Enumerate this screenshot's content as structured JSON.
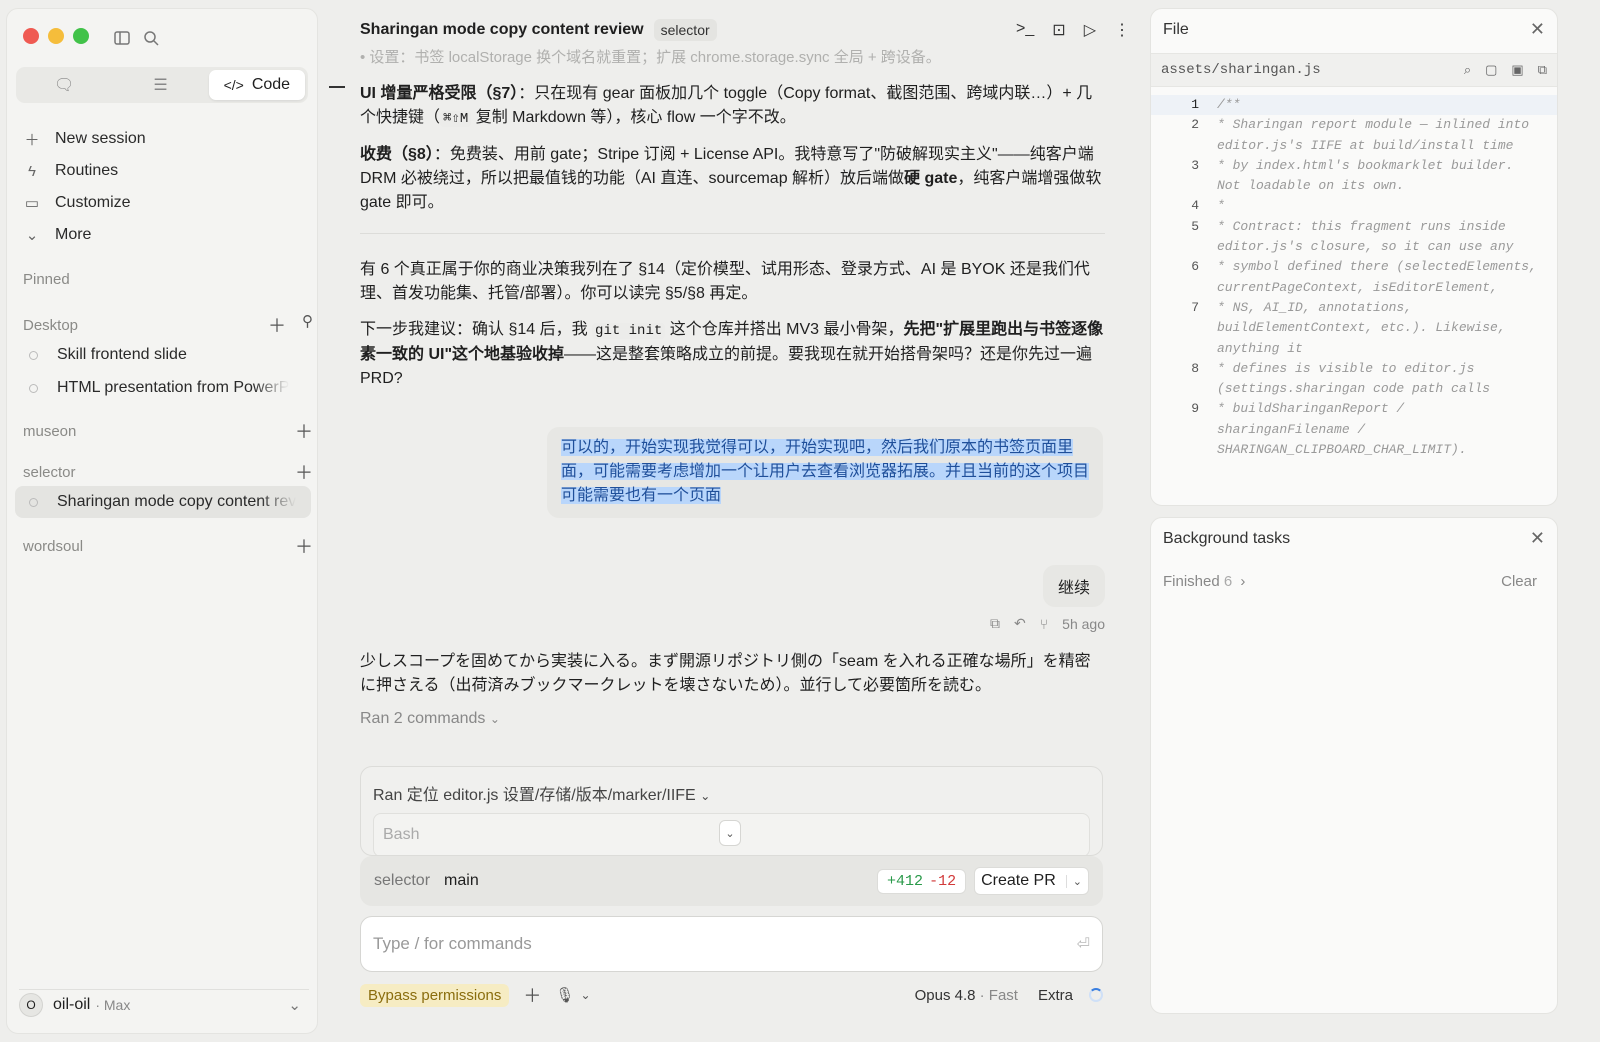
{
  "sidebar": {
    "tabs": [
      {
        "label": "",
        "icon": "chat-icon"
      },
      {
        "label": "",
        "icon": "checklist-icon"
      },
      {
        "label": "Code",
        "icon": "code-icon"
      }
    ],
    "nav": [
      {
        "label": "New session",
        "icon": "plus-icon"
      },
      {
        "label": "Routines",
        "icon": "bolt-icon"
      },
      {
        "label": "Customize",
        "icon": "briefcase-icon"
      },
      {
        "label": "More",
        "icon": "chevron-down-icon"
      }
    ],
    "pinned_label": "Pinned",
    "desktop_label": "Desktop",
    "desktop_sessions": [
      "Skill frontend slide",
      "HTML presentation from PowerP"
    ],
    "museon_label": "museon",
    "selector_label": "selector",
    "selector_session": "Sharingan mode copy content rev",
    "wordsoul_label": "wordsoul",
    "user": {
      "avatar": "O",
      "name": "oil-oil",
      "plan": "· Max"
    }
  },
  "header": {
    "title": "Sharingan mode copy content review",
    "chip": "selector"
  },
  "conversation": {
    "faded_line": "• 设置：书签 localStorage 换个域名就重置；扩展 chrome.storage.sync 全局 + 跨设备。",
    "p1_a": "UI 增量严格受限（§7）",
    "p1_b": "：只在现有 gear 面板加几个 toggle（Copy format、截图范围、跨域内联…）+ 几个快捷键（",
    "p1_kbd": "⌘⇧M",
    "p1_c": " 复制 Markdown 等），核心 flow 一个字不改。",
    "p2_a": "收费（§8）",
    "p2_b": "：免费装、用前 gate；Stripe 订阅 + License API。我特意写了\"防破解现实主义\"——纯客户端 DRM 必被绕过，所以把最值钱的功能（AI 直连、sourcemap 解析）放后端做",
    "p2_c": "硬 gate",
    "p2_d": "，纯客户端增强做软 gate 即可。",
    "p3": "有 6 个真正属于你的商业决策我列在了 §14（定价模型、试用形态、登录方式、AI 是 BYOK 还是我们代理、首发功能集、托管/部署）。你可以读完 §5/§8 再定。",
    "p4_a": "下一步我建议：确认 §14 后，我 ",
    "p4_code": "git init",
    "p4_b": " 这个仓库并搭出 MV3 最小骨架，",
    "p4_c": "先把\"扩展里跑出与书签逐像素一致的 UI\"这个地基验收掉",
    "p4_d": "——这是整套策略成立的前提。要我现在就开始搭骨架吗？还是你先过一遍 PRD?",
    "user_msg": "可以的，开始实现我觉得可以，开始实现吧，然后我们原本的书签页面里面，可能需要考虑增加一个让用户去查看浏览器拓展。并且当前的这个项目可能需要也有一个页面",
    "user_msg2": "继续",
    "time_ago": "5h ago",
    "reply": "少しスコープを固めてから実装に入る。まず開源リポジトリ側の「seam を入れる正確な場所」を精密に押さえる（出荷済みブックマークレットを壊さないため）。並行して必要箇所を読む。",
    "ran_commands": "Ran 2 commands",
    "cmd_title": "Ran 定位 editor.js 设置/存储/版本/marker/IIFE",
    "bash_label": "Bash"
  },
  "git": {
    "repo": "selector",
    "branch": "main",
    "added": "+412",
    "removed": "-12",
    "create_pr": "Create PR"
  },
  "composer": {
    "placeholder": "Type / for commands",
    "bypass": "Bypass permissions",
    "model": "Opus 4.8",
    "fast": " · Fast",
    "extra": "Extra"
  },
  "file_panel": {
    "title": "File",
    "path": "assets/sharingan.js",
    "lines": [
      {
        "n": "1",
        "text": "/**"
      },
      {
        "n": "2",
        "text": " * Sharingan report module — inlined into editor.js's IIFE at build/install time"
      },
      {
        "n": "3",
        "text": " * by index.html's bookmarklet builder. Not loadable on its own."
      },
      {
        "n": "4",
        "text": " *"
      },
      {
        "n": "5",
        "text": " * Contract: this fragment runs inside editor.js's closure, so it can use any"
      },
      {
        "n": "6",
        "text": " * symbol defined there (selectedElements, currentPageContext, isEditorElement,"
      },
      {
        "n": "7",
        "text": " * NS, AI_ID, annotations, buildElementContext, etc.). Likewise, anything it"
      },
      {
        "n": "8",
        "text": " * defines is visible to editor.js (settings.sharingan code path calls"
      },
      {
        "n": "9",
        "text": " * buildSharinganReport / sharinganFilename / SHARINGAN_CLIPBOARD_CHAR_LIMIT)."
      }
    ]
  },
  "bg_tasks": {
    "title": "Background tasks",
    "finished": "Finished",
    "count": "6",
    "clear": "Clear"
  }
}
